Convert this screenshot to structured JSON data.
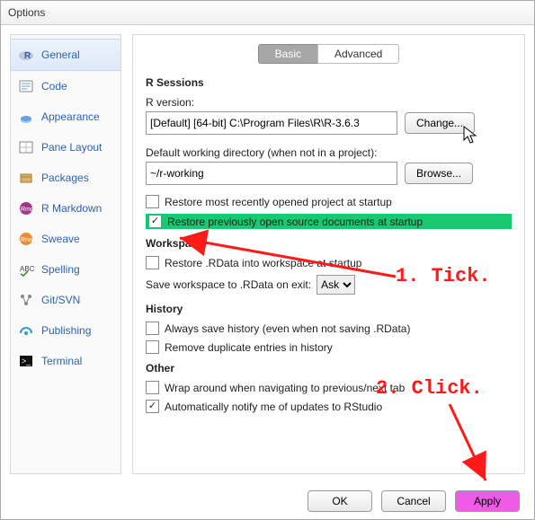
{
  "window": {
    "title": "Options"
  },
  "sidebar": {
    "items": [
      {
        "label": "General"
      },
      {
        "label": "Code"
      },
      {
        "label": "Appearance"
      },
      {
        "label": "Pane Layout"
      },
      {
        "label": "Packages"
      },
      {
        "label": "R Markdown"
      },
      {
        "label": "Sweave"
      },
      {
        "label": "Spelling"
      },
      {
        "label": "Git/SVN"
      },
      {
        "label": "Publishing"
      },
      {
        "label": "Terminal"
      }
    ]
  },
  "tabs": {
    "basic": "Basic",
    "advanced": "Advanced"
  },
  "rsessions": {
    "header": "R Sessions",
    "version_label": "R version:",
    "version_value": "[Default] [64-bit] C:\\Program Files\\R\\R-3.6.3",
    "change_btn": "Change...",
    "workdir_label": "Default working directory (when not in a project):",
    "workdir_value": "~/r-working",
    "browse_btn": "Browse...",
    "restore_project_label": "Restore most recently opened project at startup",
    "restore_docs_label": "Restore previously open source documents at startup"
  },
  "workspace": {
    "header": "Workspace",
    "restore_rdata_label": "Restore .RData into workspace at startup",
    "save_label": "Save workspace to .RData on exit:",
    "save_value": "Ask"
  },
  "history": {
    "header": "History",
    "always_save_label": "Always save history (even when not saving .RData)",
    "remove_dups_label": "Remove duplicate entries in history"
  },
  "other": {
    "header": "Other",
    "wrap_label": "Wrap around when navigating to previous/next tab",
    "notify_label": "Automatically notify me of updates to RStudio"
  },
  "footer": {
    "ok": "OK",
    "cancel": "Cancel",
    "apply": "Apply"
  },
  "annotations": {
    "tick": "1. Tick.",
    "click": "2. Click."
  }
}
